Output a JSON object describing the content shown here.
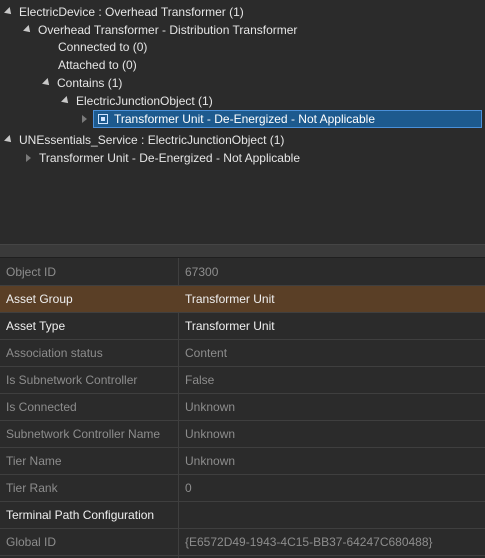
{
  "tree": {
    "root1": "ElectricDevice : Overhead Transformer (1)",
    "child1": "Overhead Transformer - Distribution Transformer",
    "connected": "Connected to (0)",
    "attached": "Attached to (0)",
    "contains": "Contains (1)",
    "junction": "ElectricJunctionObject (1)",
    "selected": "Transformer Unit - De-Energized - Not Applicable",
    "root2": "UNEssentials_Service : ElectricJunctionObject (1)",
    "child2": "Transformer Unit - De-Energized - Not Applicable"
  },
  "attributes": [
    {
      "name": "Object ID",
      "value": "67300"
    },
    {
      "name": "Asset Group",
      "value": "Transformer Unit"
    },
    {
      "name": "Asset Type",
      "value": "Transformer Unit"
    },
    {
      "name": "Association status",
      "value": "Content"
    },
    {
      "name": "Is Subnetwork Controller",
      "value": "False"
    },
    {
      "name": "Is Connected",
      "value": "Unknown"
    },
    {
      "name": "Subnetwork Controller Name",
      "value": "Unknown"
    },
    {
      "name": "Tier Name",
      "value": "Unknown"
    },
    {
      "name": "Tier Rank",
      "value": "0"
    },
    {
      "name": "Terminal Path Configuration",
      "value": ""
    },
    {
      "name": "Global ID",
      "value": "{E6572D49-1943-4C15-BB37-64247C680488}"
    }
  ],
  "colors": {
    "background": "#2b2b2b",
    "selection": "#1d5a8e",
    "highlight_row": "#5a3f26"
  }
}
